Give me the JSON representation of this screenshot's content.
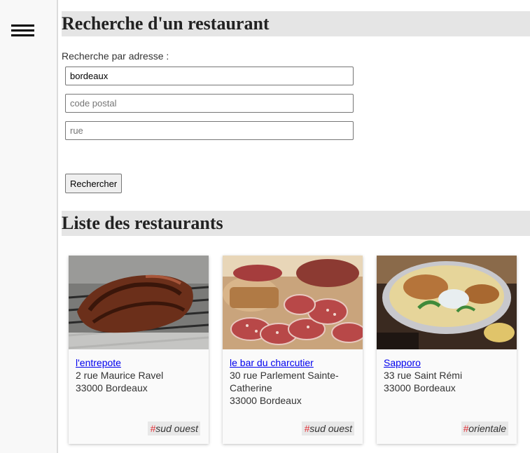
{
  "sidebar": {
    "menu_icon": "hamburger-menu-icon"
  },
  "search": {
    "title": "Recherche d'un restaurant",
    "label": "Recherche par adresse :",
    "ville_value": "bordeaux",
    "code_postal_placeholder": "code postal",
    "rue_placeholder": "rue",
    "button_label": "Rechercher"
  },
  "list": {
    "title": "Liste des restaurants",
    "restaurants": [
      {
        "name": "l'entrepote",
        "address_line1": "2 rue Maurice Ravel",
        "address_line2": "33000 Bordeaux",
        "address_line3": "",
        "tag_hash": "#",
        "tag_text": "sud ouest",
        "image_icon": "grilled-steak-photo"
      },
      {
        "name": "le bar du charcutier",
        "address_line1": "30 rue Parlement Sainte-",
        "address_line2": "Catherine",
        "address_line3": "33000 Bordeaux",
        "tag_hash": "#",
        "tag_text": "sud ouest",
        "image_icon": "charcuterie-photo"
      },
      {
        "name": "Sapporo",
        "address_line1": "33 rue Saint Rémi",
        "address_line2": "33000 Bordeaux",
        "address_line3": "",
        "tag_hash": "#",
        "tag_text": "orientale",
        "image_icon": "ramen-bowl-photo"
      }
    ]
  },
  "colors": {
    "title_bg": "#e5e5e5",
    "sidebar_bg": "#f8f8f8",
    "link": "#0000ee",
    "tag_hash": "#e0333a"
  }
}
